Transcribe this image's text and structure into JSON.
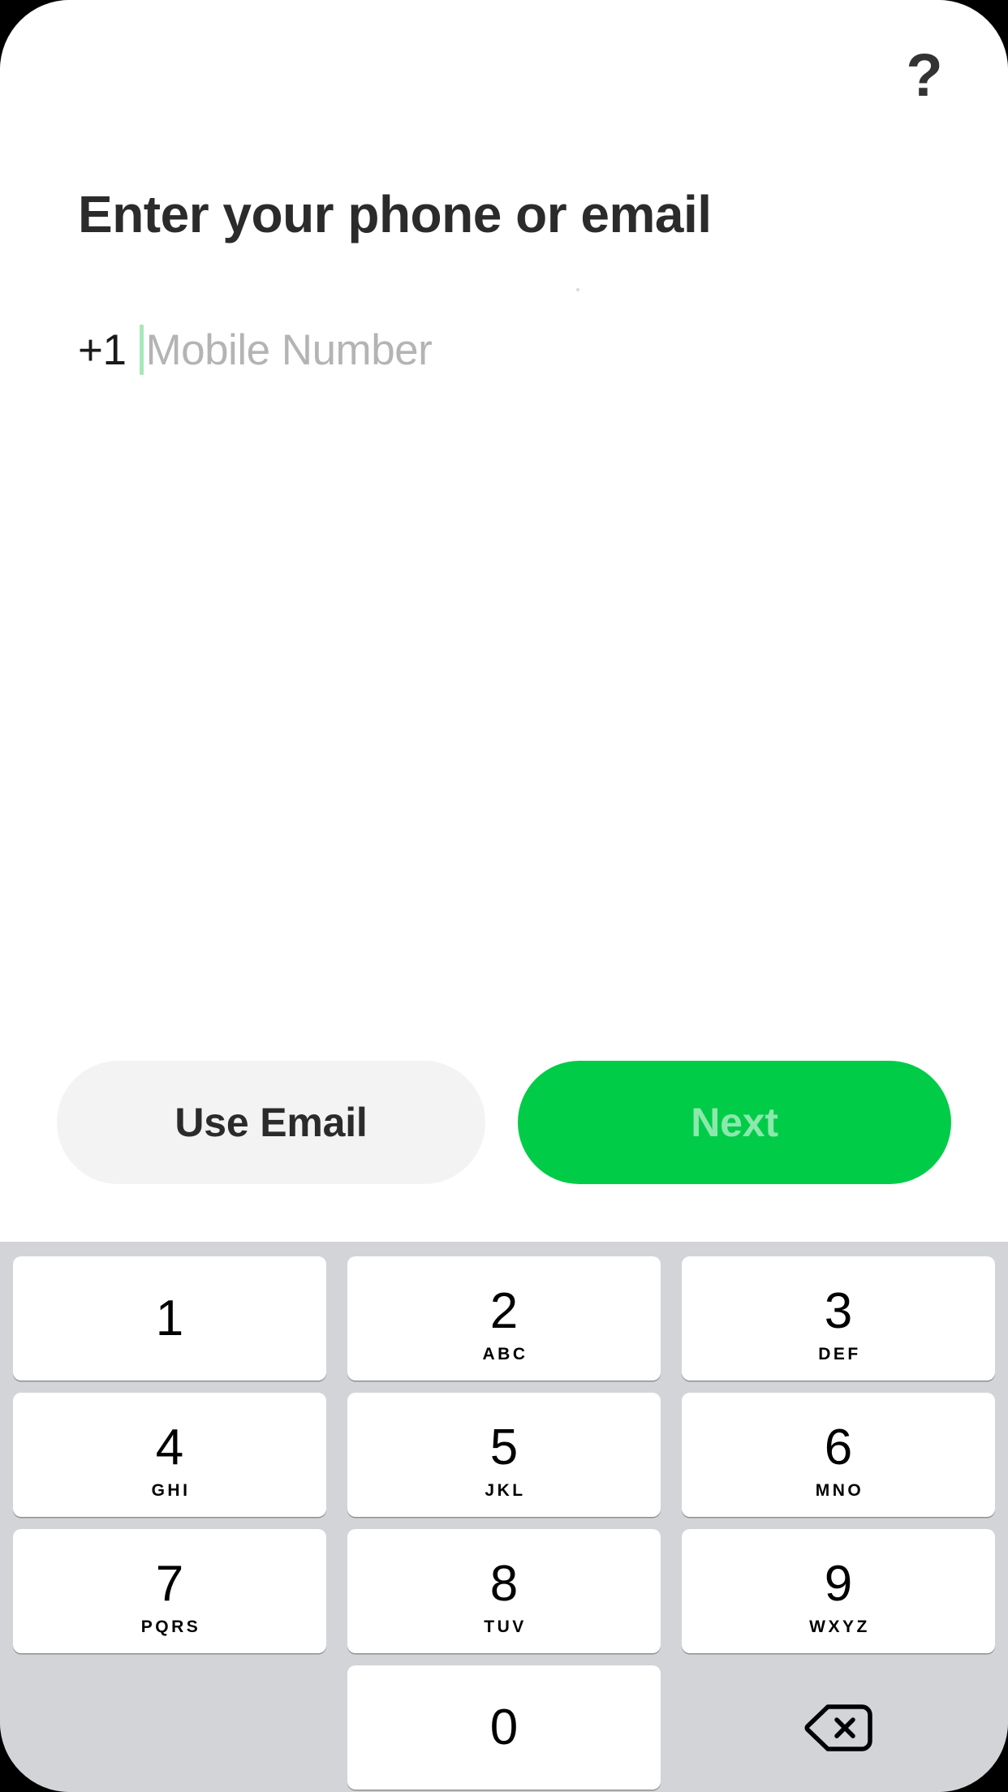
{
  "screen": {
    "title": "Enter your phone or email",
    "help_icon_label": "?"
  },
  "phone_input": {
    "country_code": "+1",
    "placeholder": "Mobile Number",
    "value": "",
    "caret_color": "#a6e9b8"
  },
  "actions": {
    "secondary_label": "Use Email",
    "primary_label": "Next",
    "primary_color": "#00cc48",
    "secondary_color": "#f3f3f3",
    "primary_text_color": "rgba(255,255,255,0.55)"
  },
  "keypad": {
    "background": "#d2d4d8",
    "keys": [
      {
        "digit": "1",
        "letters": ""
      },
      {
        "digit": "2",
        "letters": "ABC"
      },
      {
        "digit": "3",
        "letters": "DEF"
      },
      {
        "digit": "4",
        "letters": "GHI"
      },
      {
        "digit": "5",
        "letters": "JKL"
      },
      {
        "digit": "6",
        "letters": "MNO"
      },
      {
        "digit": "7",
        "letters": "PQRS"
      },
      {
        "digit": "8",
        "letters": "TUV"
      },
      {
        "digit": "9",
        "letters": "WXYZ"
      },
      {
        "digit": "0",
        "letters": ""
      }
    ],
    "backspace_icon": "backspace-icon"
  }
}
